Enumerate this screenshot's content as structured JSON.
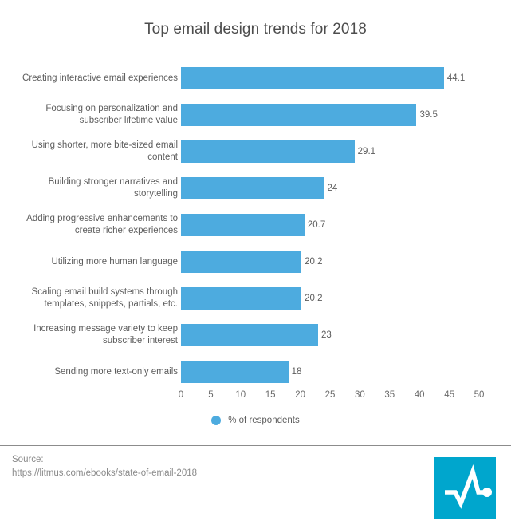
{
  "chart_data": {
    "type": "bar",
    "orientation": "horizontal",
    "title": "Top email design trends for 2018",
    "xlabel": "",
    "ylabel": "",
    "xlim": [
      0,
      50
    ],
    "xticks": [
      "0",
      "5",
      "10",
      "15",
      "20",
      "25",
      "30",
      "35",
      "40",
      "45",
      "50"
    ],
    "grid": false,
    "legend_position": "bottom",
    "legend": [
      "% of respondents"
    ],
    "series_name": "% of respondents",
    "bar_color": "#4dabdf",
    "categories": [
      "Creating interactive email experiences",
      "Focusing on personalization and subscriber lifetime value",
      "Using shorter, more bite-sized email content",
      "Building stronger narratives and storytelling",
      "Adding progressive enhancements to create richer experiences",
      "Utilizing more human language",
      "Scaling email build systems through templates, snippets, partials, etc.",
      "Increasing message variety to keep subscriber interest",
      "Sending more text-only emails"
    ],
    "category_lines": [
      [
        "Creating interactive email experiences"
      ],
      [
        "Focusing on personalization and",
        "subscriber lifetime value"
      ],
      [
        "Using shorter, more bite-sized email",
        "content"
      ],
      [
        "Building stronger narratives and",
        "storytelling"
      ],
      [
        "Adding progressive enhancements to",
        "create richer experiences"
      ],
      [
        "Utilizing more human language"
      ],
      [
        "Scaling email build systems through",
        "templates, snippets, partials, etc."
      ],
      [
        "Increasing message variety to keep",
        "subscriber interest"
      ],
      [
        "Sending more text-only emails"
      ]
    ],
    "values": [
      44.1,
      39.5,
      29.1,
      24,
      20.7,
      20.2,
      20.2,
      23,
      18
    ],
    "value_labels": [
      "44.1",
      "39.5",
      "29.1",
      "24",
      "20.7",
      "20.2",
      "20.2",
      "23",
      "18"
    ]
  },
  "footer": {
    "source_label": "Source:",
    "source_url": "https://litmus.com/ebooks/state-of-email-2018",
    "logo_color": "#00a6cd",
    "logo_name": "pulse-logo"
  }
}
